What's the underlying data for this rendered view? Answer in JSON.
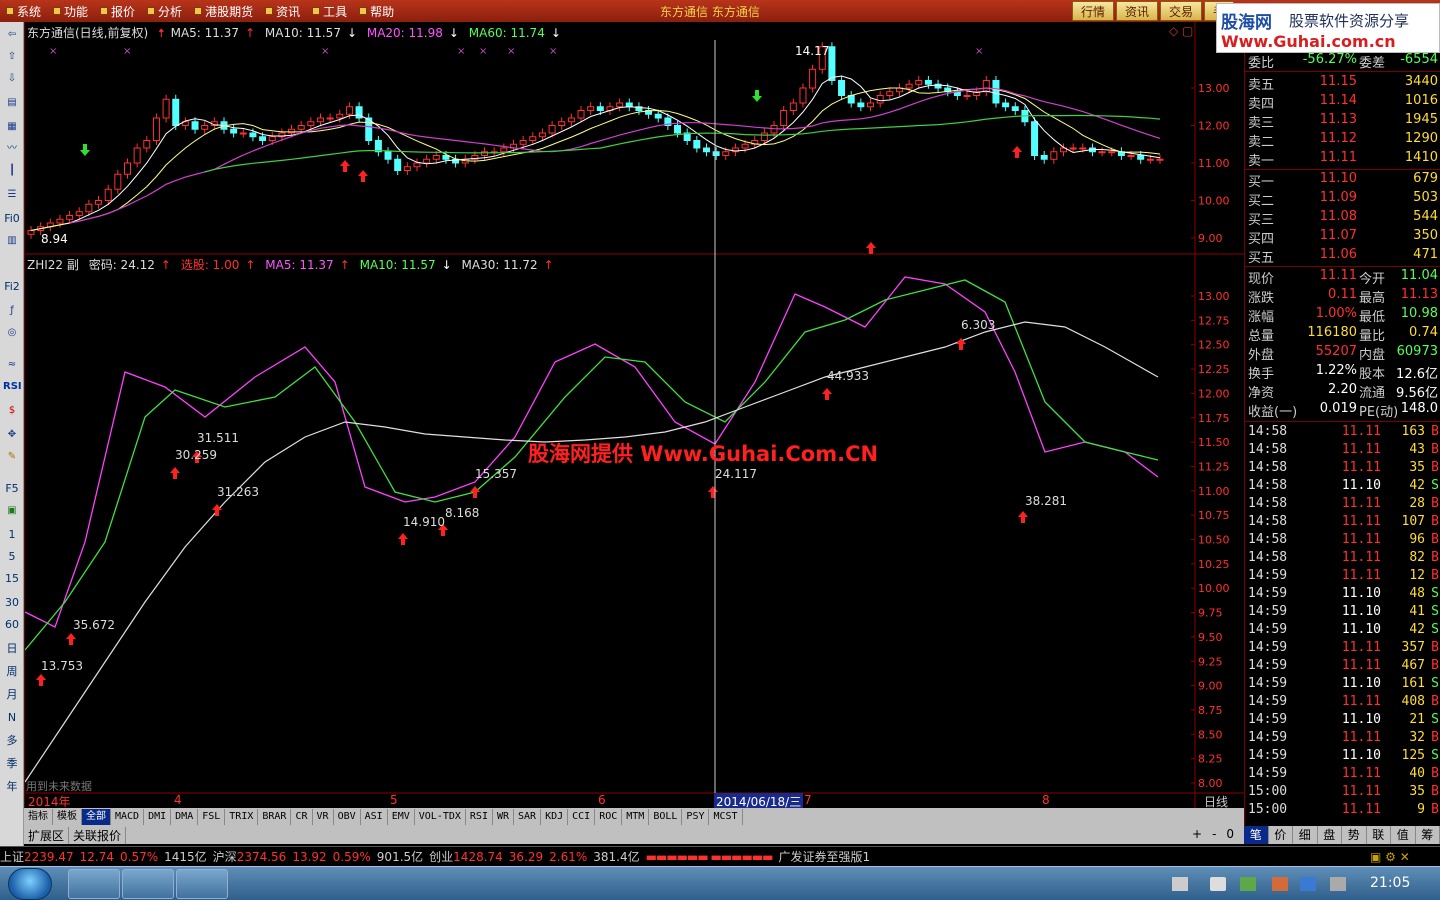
{
  "menu": {
    "items": [
      "系统",
      "功能",
      "报价",
      "分析",
      "港股期货",
      "资讯",
      "工具",
      "帮助"
    ],
    "window_title": "东方通信  东方通信",
    "top_tabs": [
      "行情",
      "资讯",
      "交易",
      "手"
    ]
  },
  "brand": {
    "name": "股海网",
    "slogan": "股票软件资源分享",
    "url": "Www.Guhai.com.cn"
  },
  "main_chart": {
    "title": "东方通信(日线,前复权)",
    "legend": [
      {
        "label": "MA5: 11.37",
        "dir": "up",
        "color": "#ffffff"
      },
      {
        "label": "MA10: 11.57",
        "dir": "down",
        "color": "#ffffff"
      },
      {
        "label": "MA20: 11.98",
        "dir": "down",
        "color": "#ff55ff"
      },
      {
        "label": "MA60: 11.74",
        "dir": "down",
        "color": "#55ff55"
      }
    ],
    "high_label": "14.17",
    "low_label": "8.94",
    "y_ticks": [
      "13.00",
      "12.00",
      "11.00",
      "10.00",
      "9.00"
    ]
  },
  "sub_chart": {
    "title": "ZHI22 副",
    "legend": [
      {
        "label": "密码: 24.12",
        "dir": "up",
        "color": "#dddddd"
      },
      {
        "label": "选股: 1.00",
        "dir": "up",
        "color": "#ff3030"
      },
      {
        "label": "MA5: 11.37",
        "dir": "up",
        "color": "#ff55ff"
      },
      {
        "label": "MA10: 11.57",
        "dir": "down",
        "color": "#55ff55"
      },
      {
        "label": "MA30: 11.72",
        "dir": "up",
        "color": "#dddddd"
      }
    ],
    "y_ticks": [
      "13.00",
      "12.75",
      "12.50",
      "12.25",
      "12.00",
      "11.75",
      "11.50",
      "11.25",
      "11.00",
      "10.75",
      "10.50",
      "10.25",
      "10.00",
      "9.75",
      "9.50",
      "9.25",
      "9.00",
      "8.75",
      "8.50",
      "8.25",
      "8.00"
    ],
    "signals": [
      "13.753",
      "35.672",
      "30.259",
      "31.511",
      "31.263",
      "14.910",
      "8.168",
      "15.357",
      "24.117",
      "44.933",
      "6.303",
      "38.281"
    ],
    "watermark": "股海网提供 Www.Guhai.Com.CN",
    "future_note": "用到未来数据"
  },
  "date_axis": {
    "labels": [
      "2014年",
      "4",
      "5",
      "6",
      "2014/06/18/三",
      "7",
      "8"
    ],
    "period": "日线"
  },
  "indicator_tabs": [
    "指标",
    "模板",
    "全部",
    "MACD",
    "DMI",
    "DMA",
    "FSL",
    "TRIX",
    "BRAR",
    "CR",
    "VR",
    "OBV",
    "ASI",
    "EMV",
    "VOL-TDX",
    "RSI",
    "WR",
    "SAR",
    "KDJ",
    "CCI",
    "ROC",
    "MTM",
    "BOLL",
    "PSY",
    "MCST"
  ],
  "sub_tabs": [
    "扩展区",
    "关联报价"
  ],
  "zoom_controls": [
    "+",
    "-",
    "0"
  ],
  "left_tools": [
    "Fi0",
    "Fi2",
    "RSI",
    "F5",
    "1",
    "5",
    "15",
    "30",
    "60",
    "日",
    "周",
    "月",
    "N",
    "多",
    "季",
    "年"
  ],
  "quote": {
    "weibi": {
      "label": "委比",
      "value": "-56.27%",
      "label2": "委差",
      "value2": "-6554"
    },
    "asks": [
      {
        "label": "卖五",
        "price": "11.15",
        "qty": "3440"
      },
      {
        "label": "卖四",
        "price": "11.14",
        "qty": "1016"
      },
      {
        "label": "卖三",
        "price": "11.13",
        "qty": "1945"
      },
      {
        "label": "卖二",
        "price": "11.12",
        "qty": "1290"
      },
      {
        "label": "卖一",
        "price": "11.11",
        "qty": "1410"
      }
    ],
    "bids": [
      {
        "label": "买一",
        "price": "11.10",
        "qty": "679"
      },
      {
        "label": "买二",
        "price": "11.09",
        "qty": "503"
      },
      {
        "label": "买三",
        "price": "11.08",
        "qty": "544"
      },
      {
        "label": "买四",
        "price": "11.07",
        "qty": "350"
      },
      {
        "label": "买五",
        "price": "11.06",
        "qty": "471"
      }
    ],
    "stats": [
      {
        "k1": "现价",
        "v1": "11.11",
        "c1": "#ff3030",
        "k2": "今开",
        "v2": "11.04",
        "c2": "#55ff55"
      },
      {
        "k1": "涨跌",
        "v1": "0.11",
        "c1": "#ff3030",
        "k2": "最高",
        "v2": "11.13",
        "c2": "#ff3030"
      },
      {
        "k1": "涨幅",
        "v1": "1.00%",
        "c1": "#ff3030",
        "k2": "最低",
        "v2": "10.98",
        "c2": "#55ff55"
      },
      {
        "k1": "总量",
        "v1": "116180",
        "c1": "#ffdd33",
        "k2": "量比",
        "v2": "0.74",
        "c2": "#ffdd33"
      },
      {
        "k1": "外盘",
        "v1": "55207",
        "c1": "#ff3030",
        "k2": "内盘",
        "v2": "60973",
        "c2": "#55ff55"
      },
      {
        "k1": "换手",
        "v1": "1.22%",
        "c1": "#ffffff",
        "k2": "股本",
        "v2": "12.6亿",
        "c2": "#ffffff"
      },
      {
        "k1": "净资",
        "v1": "2.20",
        "c1": "#ffffff",
        "k2": "流通",
        "v2": "9.56亿",
        "c2": "#ffffff"
      },
      {
        "k1": "收益(一)",
        "v1": "0.019",
        "c1": "#ffffff",
        "k2": "PE(动)",
        "v2": "148.0",
        "c2": "#ffffff"
      }
    ],
    "ticks": [
      {
        "time": "14:58",
        "price": "11.11",
        "vol": "163",
        "side": "B"
      },
      {
        "time": "14:58",
        "price": "11.11",
        "vol": "43",
        "side": "B"
      },
      {
        "time": "14:58",
        "price": "11.11",
        "vol": "35",
        "side": "B"
      },
      {
        "time": "14:58",
        "price": "11.10",
        "vol": "42",
        "side": "S"
      },
      {
        "time": "14:58",
        "price": "11.11",
        "vol": "28",
        "side": "B"
      },
      {
        "time": "14:58",
        "price": "11.11",
        "vol": "107",
        "side": "B"
      },
      {
        "time": "14:58",
        "price": "11.11",
        "vol": "96",
        "side": "B"
      },
      {
        "time": "14:58",
        "price": "11.11",
        "vol": "82",
        "side": "B"
      },
      {
        "time": "14:59",
        "price": "11.11",
        "vol": "12",
        "side": "B"
      },
      {
        "time": "14:59",
        "price": "11.10",
        "vol": "48",
        "side": "S"
      },
      {
        "time": "14:59",
        "price": "11.10",
        "vol": "41",
        "side": "S"
      },
      {
        "time": "14:59",
        "price": "11.10",
        "vol": "42",
        "side": "S"
      },
      {
        "time": "14:59",
        "price": "11.11",
        "vol": "357",
        "side": "B"
      },
      {
        "time": "14:59",
        "price": "11.11",
        "vol": "467",
        "side": "B"
      },
      {
        "time": "14:59",
        "price": "11.10",
        "vol": "161",
        "side": "S"
      },
      {
        "time": "14:59",
        "price": "11.11",
        "vol": "408",
        "side": "B"
      },
      {
        "time": "14:59",
        "price": "11.10",
        "vol": "21",
        "side": "S"
      },
      {
        "time": "14:59",
        "price": "11.11",
        "vol": "32",
        "side": "B"
      },
      {
        "time": "14:59",
        "price": "11.10",
        "vol": "125",
        "side": "S"
      },
      {
        "time": "14:59",
        "price": "11.11",
        "vol": "40",
        "side": "B"
      },
      {
        "time": "15:00",
        "price": "11.11",
        "vol": "35",
        "side": "B"
      },
      {
        "time": "15:00",
        "price": "11.11",
        "vol": "9",
        "side": "B"
      }
    ],
    "tabs": [
      "笔",
      "价",
      "细",
      "盘",
      "势",
      "联",
      "值",
      "筹"
    ]
  },
  "status": {
    "sh_label": "上证",
    "sh_value": "2239.47",
    "sh_change": "12.74",
    "sh_pct": "0.57%",
    "sh_amount": "1415亿",
    "hs_label": "沪深",
    "hs_value": "2374.56",
    "hs_change": "13.92",
    "hs_pct": "0.59%",
    "hs_amount": "901.5亿",
    "cy_label": "创业",
    "cy_value": "1428.74",
    "cy_change": "36.29",
    "cy_pct": "2.61%",
    "cy_amount": "381.4亿",
    "broker": "广发证券至强版1"
  },
  "taskbar": {
    "clock": "21:05"
  },
  "colors": {
    "up": "#ff3030",
    "down": "#55ff55",
    "accent": "#ffdd33",
    "frame": "#7a0000"
  }
}
